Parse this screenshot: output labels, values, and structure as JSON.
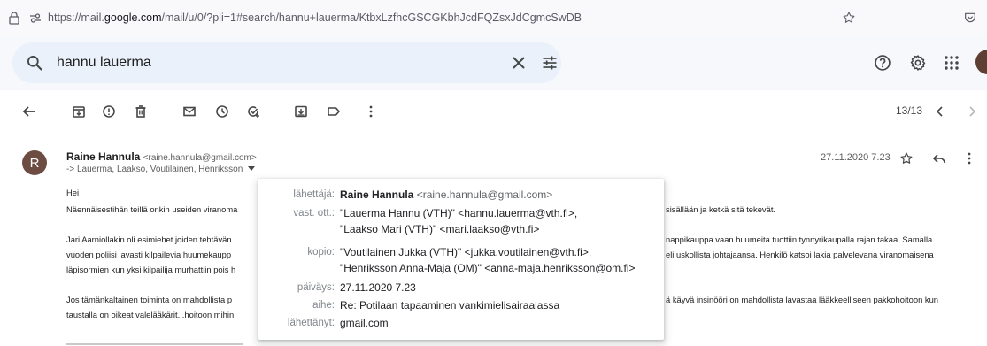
{
  "browser": {
    "url_prefix": "https://mail.",
    "url_domain": "google.com",
    "url_rest": "/mail/u/0/?pli=1#search/hannu+lauerma/KtbxLzfhcGSCGKbhJcdFQZsxJdCgmcSwDB"
  },
  "search": {
    "value": "hannu lauerma"
  },
  "pager": {
    "count": "13/13"
  },
  "message": {
    "avatar_letter": "R",
    "sender_name": "Raine Hannula",
    "sender_email": "<raine.hannula@gmail.com>",
    "recipients": "-> Lauerma, Laakso, Voutilainen, Henriksson",
    "date": "27.11.2020 7.23"
  },
  "body": {
    "greeting": "Hei",
    "p1_left": "Näennäisestihän teillä onkin useiden viranoma",
    "p1_right": "sisällään ja ketkä sitä tekevät.",
    "p2_l1_left": "Jari Aarniollakin oli esimiehet joiden tehtävän",
    "p2_l1_right": "nappikauppa vaan huumeita tuottiin tynnyrikaupalla rajan takaa. Samalla",
    "p2_l2_left": "vuoden poliisi lavasti kilpailevia huumekaupp",
    "p2_l2_right": "eli uskollista johtajaansa. Henkilö katsoi lakia palvelevana viranomaisena",
    "p2_l3_left": "läpisormien kun yksi kilpailija murhattiin pois h",
    "p3_l1_left": "Jos tämänkaltainen toiminta on mahdollista p",
    "p3_l1_right": "ä käyvä insinööri on mahdollista lavastaa lääkkeelliseen pakkohoitoon kun",
    "p3_l2_left": "taustalla on oikeat valelääkärit...hoitoon mihin"
  },
  "popup": {
    "from_label": "lähettäjä:",
    "from_name": "Raine Hannula",
    "from_email": "<raine.hannula@gmail.com>",
    "to_label": "vast. ott.:",
    "to_line1": "\"Lauerma Hannu (VTH)\" <hannu.lauerma@vth.fi>,",
    "to_line2": "\"Laakso Mari (VTH)\" <mari.laakso@vth.fi>",
    "cc_label": "kopio:",
    "cc_line1": "\"Voutilainen Jukka (VTH)\" <jukka.voutilainen@vth.fi>,",
    "cc_line2": "\"Henriksson Anna-Maja (OM)\" <anna-maja.henriksson@om.fi>",
    "date_label": "päiväys:",
    "date_value": "27.11.2020 7.23",
    "subject_label": "aihe:",
    "subject_value": "Re: Potilaan tapaaminen vankimielisairaalassa",
    "mailedby_label": "lähettänyt:",
    "mailedby_value": "gmail.com"
  },
  "colors": {
    "avatar": "#6d4c41",
    "search_bg": "#eaf1fb",
    "page_bg": "#f6f8fc"
  }
}
